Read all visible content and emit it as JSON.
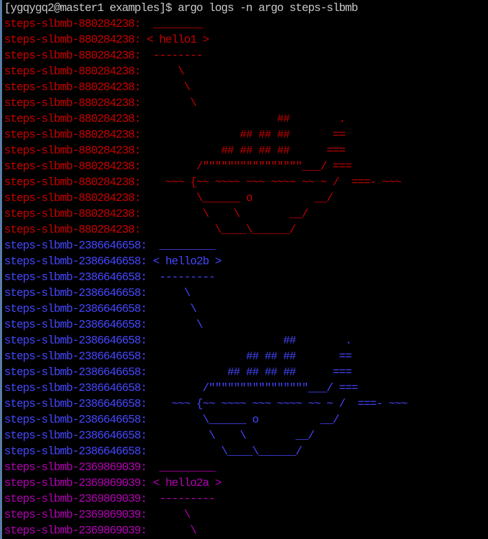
{
  "terminal": {
    "prompt_line": "[ygqygq2@master1 examples]$ argo logs -n argo steps-slbmb",
    "colors": {
      "background": "#000000",
      "prompt": "#c9c9c9",
      "red": "#c80000",
      "blue": "#4646ff",
      "magenta": "#b400b4"
    },
    "lines": [
      {
        "prefix": "steps-slbmb-880284238:",
        "text": "  ________",
        "color": "red"
      },
      {
        "prefix": "steps-slbmb-880284238:",
        "text": " < hello1 >",
        "color": "red"
      },
      {
        "prefix": "steps-slbmb-880284238:",
        "text": "  --------",
        "color": "red"
      },
      {
        "prefix": "steps-slbmb-880284238:",
        "text": "      \\",
        "color": "red"
      },
      {
        "prefix": "steps-slbmb-880284238:",
        "text": "       \\",
        "color": "red"
      },
      {
        "prefix": "steps-slbmb-880284238:",
        "text": "        \\",
        "color": "red"
      },
      {
        "prefix": "steps-slbmb-880284238:",
        "text": "                      ##        .",
        "color": "red"
      },
      {
        "prefix": "steps-slbmb-880284238:",
        "text": "                ## ## ##       ==",
        "color": "red"
      },
      {
        "prefix": "steps-slbmb-880284238:",
        "text": "             ## ## ## ##      ===",
        "color": "red"
      },
      {
        "prefix": "steps-slbmb-880284238:",
        "text": "         /\"\"\"\"\"\"\"\"\"\"\"\"\"\"\"\"___/ ===",
        "color": "red"
      },
      {
        "prefix": "steps-slbmb-880284238:",
        "text": "    ~~~ {~~ ~~~~ ~~~ ~~~~ ~~ ~ /  ===- ~~~",
        "color": "red"
      },
      {
        "prefix": "steps-slbmb-880284238:",
        "text": "         \\______ o          __/",
        "color": "red"
      },
      {
        "prefix": "steps-slbmb-880284238:",
        "text": "          \\    \\        __/",
        "color": "red"
      },
      {
        "prefix": "steps-slbmb-880284238:",
        "text": "            \\____\\______/",
        "color": "red"
      },
      {
        "prefix": "steps-slbmb-2386646658:",
        "text": "  _________",
        "color": "blue"
      },
      {
        "prefix": "steps-slbmb-2386646658:",
        "text": " < hello2b >",
        "color": "blue"
      },
      {
        "prefix": "steps-slbmb-2386646658:",
        "text": "  ---------",
        "color": "blue"
      },
      {
        "prefix": "steps-slbmb-2386646658:",
        "text": "      \\",
        "color": "blue"
      },
      {
        "prefix": "steps-slbmb-2386646658:",
        "text": "       \\",
        "color": "blue"
      },
      {
        "prefix": "steps-slbmb-2386646658:",
        "text": "        \\",
        "color": "blue"
      },
      {
        "prefix": "steps-slbmb-2386646658:",
        "text": "                      ##        .",
        "color": "blue"
      },
      {
        "prefix": "steps-slbmb-2386646658:",
        "text": "                ## ## ##       ==",
        "color": "blue"
      },
      {
        "prefix": "steps-slbmb-2386646658:",
        "text": "             ## ## ## ##      ===",
        "color": "blue"
      },
      {
        "prefix": "steps-slbmb-2386646658:",
        "text": "         /\"\"\"\"\"\"\"\"\"\"\"\"\"\"\"\"___/ ===",
        "color": "blue"
      },
      {
        "prefix": "steps-slbmb-2386646658:",
        "text": "    ~~~ {~~ ~~~~ ~~~ ~~~~ ~~ ~ /  ===- ~~~",
        "color": "blue"
      },
      {
        "prefix": "steps-slbmb-2386646658:",
        "text": "         \\______ o          __/",
        "color": "blue"
      },
      {
        "prefix": "steps-slbmb-2386646658:",
        "text": "          \\    \\        __/",
        "color": "blue"
      },
      {
        "prefix": "steps-slbmb-2386646658:",
        "text": "            \\____\\______/",
        "color": "blue"
      },
      {
        "prefix": "steps-slbmb-2369869039:",
        "text": "  _________",
        "color": "magenta"
      },
      {
        "prefix": "steps-slbmb-2369869039:",
        "text": " < hello2a >",
        "color": "magenta"
      },
      {
        "prefix": "steps-slbmb-2369869039:",
        "text": "  ---------",
        "color": "magenta"
      },
      {
        "prefix": "steps-slbmb-2369869039:",
        "text": "      \\",
        "color": "magenta"
      },
      {
        "prefix": "steps-slbmb-2369869039:",
        "text": "       \\",
        "color": "magenta"
      }
    ]
  }
}
